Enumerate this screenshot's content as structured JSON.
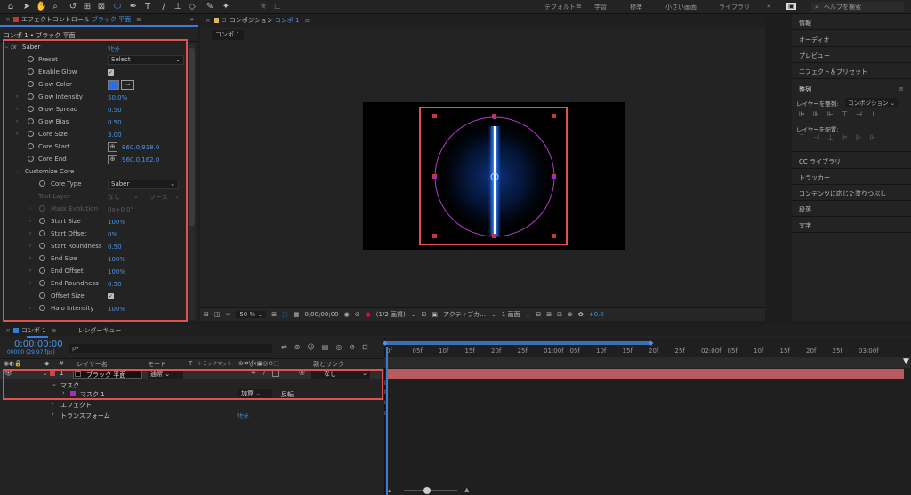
{
  "toolbar": {
    "icons": [
      "home-icon",
      "selection-tool-icon",
      "hand-tool-icon",
      "zoom-tool-icon",
      "rotate-tool-icon",
      "camera-tool-icon",
      "pan-behind-tool-icon",
      "ellipse-tool-icon",
      "pen-tool-icon",
      "type-tool-icon",
      "brush-tool-icon",
      "clone-stamp-tool-icon",
      "eraser-tool-icon",
      "roto-brush-tool-icon",
      "puppet-tool-icon"
    ],
    "workspaces": [
      "デフォルト",
      "学習",
      "標準",
      "小さい画面",
      "ライブラリ"
    ],
    "search_placeholder": "ヘルプを検索"
  },
  "effect_controls": {
    "tab_title": "エフェクトコントロール",
    "tab_layer": "ブラック 平面",
    "breadcrumb": "コンポ 1 • ブラック 平面",
    "effect_name": "Saber",
    "reset_label": "ﾘｾｯﾄ",
    "props": [
      {
        "name": "Preset",
        "value": "Select",
        "kind": "dropdown"
      },
      {
        "name": "Enable Glow",
        "value": "✓",
        "kind": "check"
      },
      {
        "name": "Glow Color",
        "value": "",
        "kind": "color"
      },
      {
        "name": "Glow Intensity",
        "value": "50.0%",
        "kind": "num"
      },
      {
        "name": "Glow Spread",
        "value": "0.50",
        "kind": "num"
      },
      {
        "name": "Glow Bias",
        "value": "0.50",
        "kind": "num"
      },
      {
        "name": "Core Size",
        "value": "3.00",
        "kind": "num"
      },
      {
        "name": "Core Start",
        "value": "960.0,918.0",
        "kind": "point"
      },
      {
        "name": "Core End",
        "value": "960.0,162.0",
        "kind": "point"
      },
      {
        "name": "Customize Core",
        "value": "",
        "kind": "group"
      },
      {
        "name": "Core Type",
        "value": "Saber",
        "kind": "dropdown"
      },
      {
        "name": "Text Layer",
        "value": "なし",
        "value2": "ソース",
        "kind": "disabled2"
      },
      {
        "name": "Mask Evolution",
        "value": "0x+0.0°",
        "kind": "disabled"
      },
      {
        "name": "Start Size",
        "value": "100%",
        "kind": "num"
      },
      {
        "name": "Start Offset",
        "value": "0%",
        "kind": "num"
      },
      {
        "name": "Start Roundness",
        "value": "0.50",
        "kind": "num"
      },
      {
        "name": "End Size",
        "value": "100%",
        "kind": "num"
      },
      {
        "name": "End Offset",
        "value": "100%",
        "kind": "num"
      },
      {
        "name": "End Roundness",
        "value": "0.50",
        "kind": "num"
      },
      {
        "name": "Offset Size",
        "value": "✓",
        "kind": "check"
      },
      {
        "name": "Halo Intensity",
        "value": "100%",
        "kind": "num"
      }
    ]
  },
  "composition": {
    "tab_title": "コンポジション",
    "tab_comp": "コンポ 1",
    "sub_tab": "コンポ 1",
    "zoom": "50 %",
    "timecode": "0;00;00;00",
    "resolution": "(1/2 画質)",
    "camera": "アクティブカ...",
    "views": "1 画面",
    "exposure": "+0.0"
  },
  "right_panel": {
    "items": [
      "情報",
      "オーディオ",
      "プレビュー",
      "エフェクト＆プリセット",
      "整列",
      "CC ライブラリ",
      "トラッカー",
      "コンテンツに応じた塗りつぶし",
      "段落",
      "文字"
    ],
    "align_to_label": "レイヤーを整列:",
    "align_to_value": "コンポジション",
    "distribute_label": "レイヤーを配置:"
  },
  "timeline": {
    "tab_comp": "コンポ 1",
    "tab_render": "レンダーキュー",
    "timecode": "0;00;00;00",
    "timecode_sub": "00000 (29.97 fps)",
    "search_placeholder": "ρ▾",
    "col_layer_name": "レイヤー名",
    "col_mode": "モード",
    "col_t": "T",
    "col_trkmat": "トラックマット",
    "col_parent": "親とリンク",
    "layer_index": "1",
    "layer_name": "ブラック 平面",
    "layer_mode": "通常",
    "layer_parent": "なし",
    "mask_group": "マスク",
    "mask_name": "マスク 1",
    "mask_mode": "加算",
    "mask_invert": "反転",
    "effect_group": "エフェクト",
    "transform_group": "トランスフォーム",
    "transform_reset": "ﾘｾｯﾄ",
    "ruler": [
      "0f",
      "05f",
      "10f",
      "15f",
      "20f",
      "25f",
      "01:00f",
      "05f",
      "10f",
      "15f",
      "20f",
      "25f",
      "02:00f",
      "05f",
      "10f",
      "15f",
      "20f",
      "25f",
      "03:00f"
    ]
  },
  "colors": {
    "accent": "#4a94e8",
    "highlight_red": "#e2504f",
    "glow_color": "#2b6fe8",
    "layer_bar": "#b95a5e"
  }
}
